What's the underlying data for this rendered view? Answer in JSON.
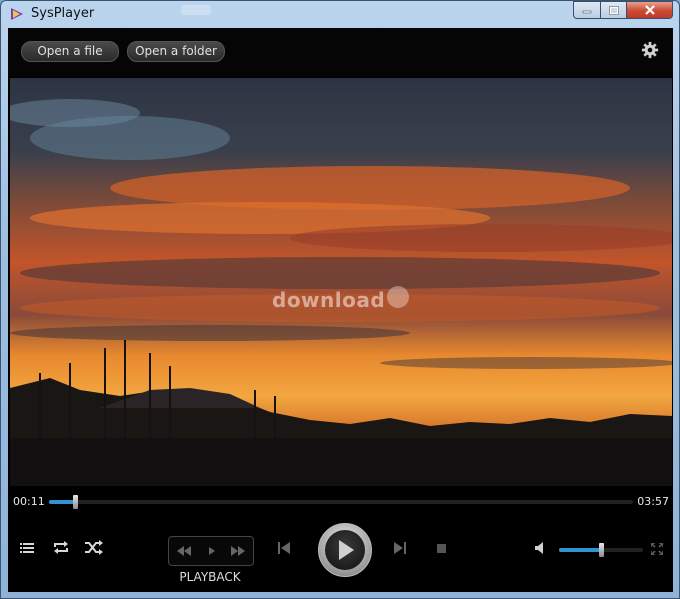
{
  "window": {
    "title": "SysPlayer"
  },
  "toolbar": {
    "open_file_label": "Open a file",
    "open_folder_label": "Open a folder",
    "settings_icon": "gear-icon"
  },
  "video": {
    "watermark": "download"
  },
  "playback": {
    "current_time": "00:11",
    "duration": "03:57",
    "progress_fraction": 0.045,
    "volume_fraction": 0.5,
    "group_label": "PLAYBACK"
  },
  "colors": {
    "accent": "#2f93d4",
    "close_button": "#c94a33",
    "background": "#000000"
  }
}
